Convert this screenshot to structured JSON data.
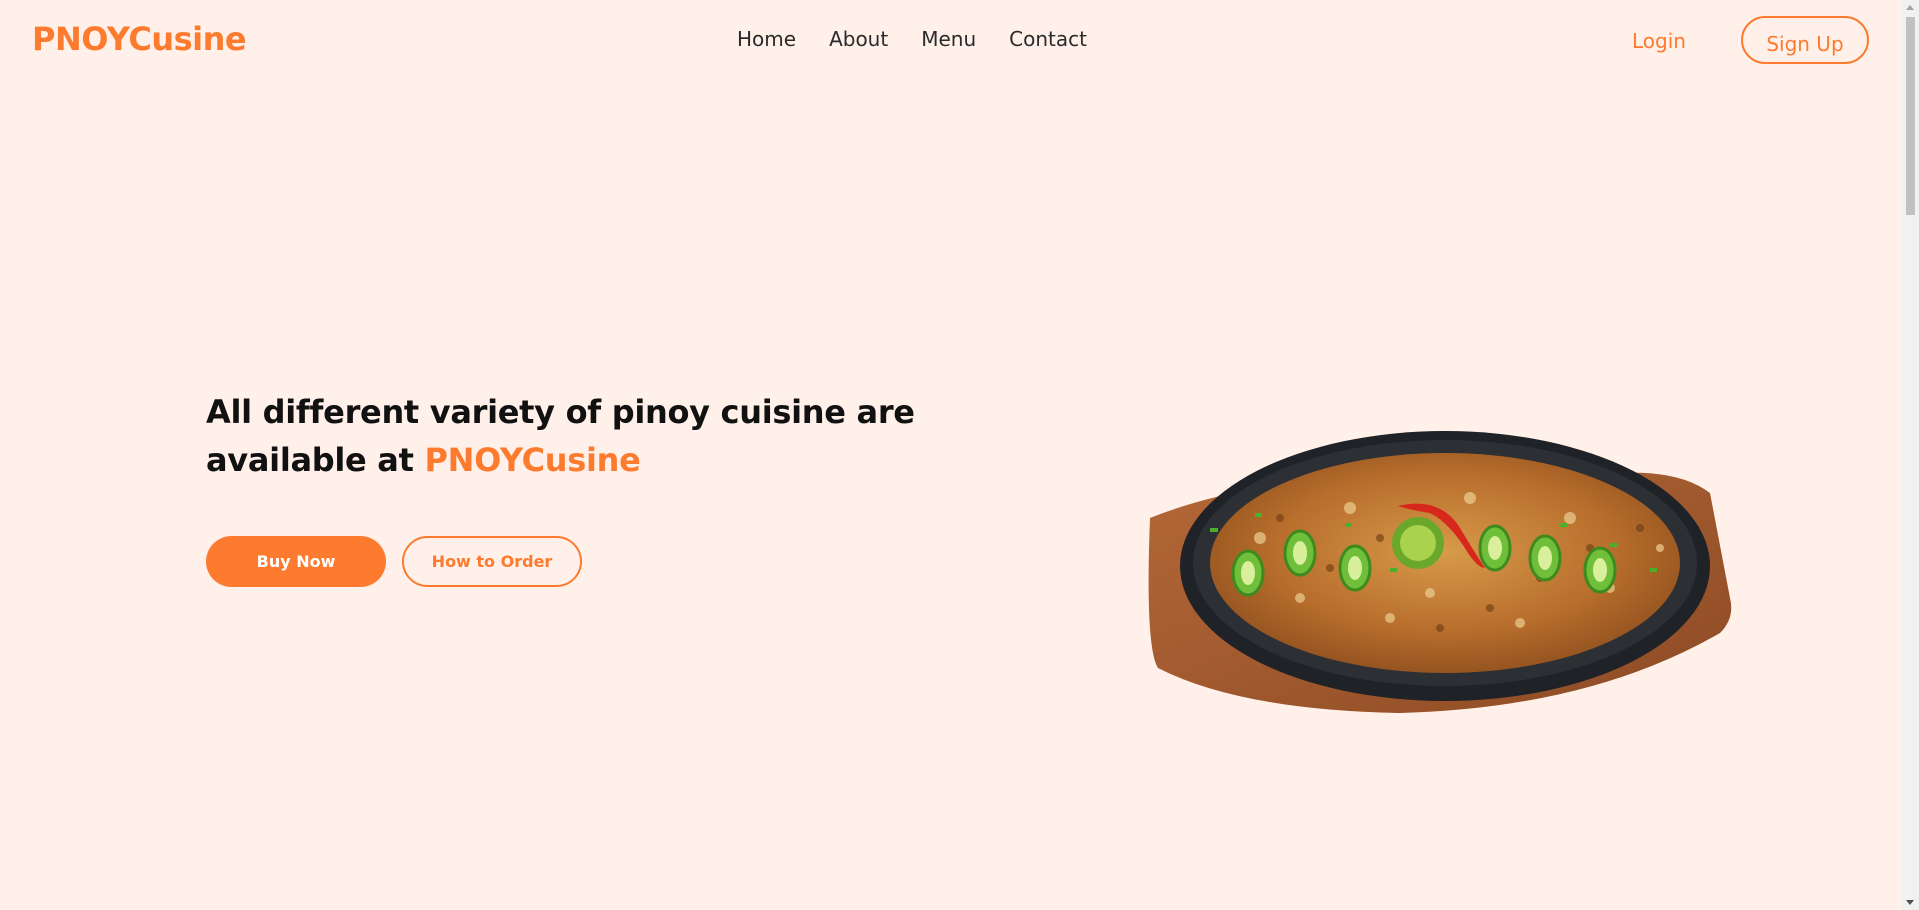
{
  "header": {
    "logo": "PNOYCusine",
    "nav": [
      {
        "label": "Home"
      },
      {
        "label": "About"
      },
      {
        "label": "Menu"
      },
      {
        "label": "Contact"
      }
    ],
    "login_label": "Login",
    "signup_label": "Sign Up"
  },
  "hero": {
    "title_prefix": "All different variety of pinoy cuisine are available at ",
    "title_brand": "PNOYCusine",
    "buy_label": "Buy Now",
    "how_label": "How to Order"
  },
  "colors": {
    "accent": "#fd7b2f",
    "background": "#fff0e9",
    "text": "#111111"
  },
  "icons": {
    "dish_image": "sisig-sizzling-plate-image"
  }
}
